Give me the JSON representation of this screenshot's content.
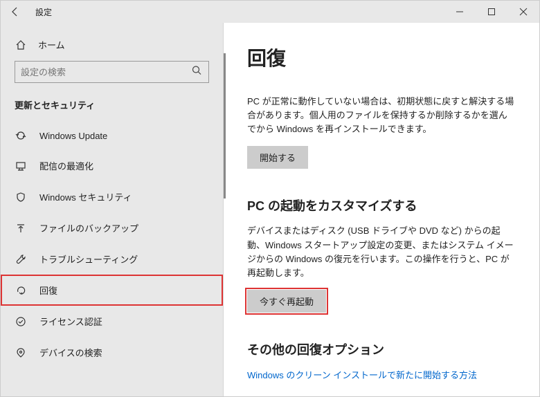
{
  "titlebar": {
    "title": "設定"
  },
  "sidebar": {
    "home_label": "ホーム",
    "search_placeholder": "設定の検索",
    "section_label": "更新とセキュリティ",
    "items": [
      {
        "label": "Windows Update"
      },
      {
        "label": "配信の最適化"
      },
      {
        "label": "Windows セキュリティ"
      },
      {
        "label": "ファイルのバックアップ"
      },
      {
        "label": "トラブルシューティング"
      },
      {
        "label": "回復"
      },
      {
        "label": "ライセンス認証"
      },
      {
        "label": "デバイスの検索"
      }
    ]
  },
  "main": {
    "heading": "回復",
    "section1": {
      "body": "PC が正常に動作していない場合は、初期状態に戻すと解決する場合があります。個人用のファイルを保持するか削除するかを選んでから Windows を再インストールできます。",
      "button": "開始する"
    },
    "section2": {
      "title": "PC の起動をカスタマイズする",
      "body": "デバイスまたはディスク (USB ドライブや DVD など) からの起動、Windows スタートアップ設定の変更、またはシステム イメージからの Windows の復元を行います。この操作を行うと、PC が再起動します。",
      "button": "今すぐ再起動"
    },
    "section3": {
      "title": "その他の回復オプション",
      "link": "Windows のクリーン インストールで新たに開始する方法"
    }
  }
}
